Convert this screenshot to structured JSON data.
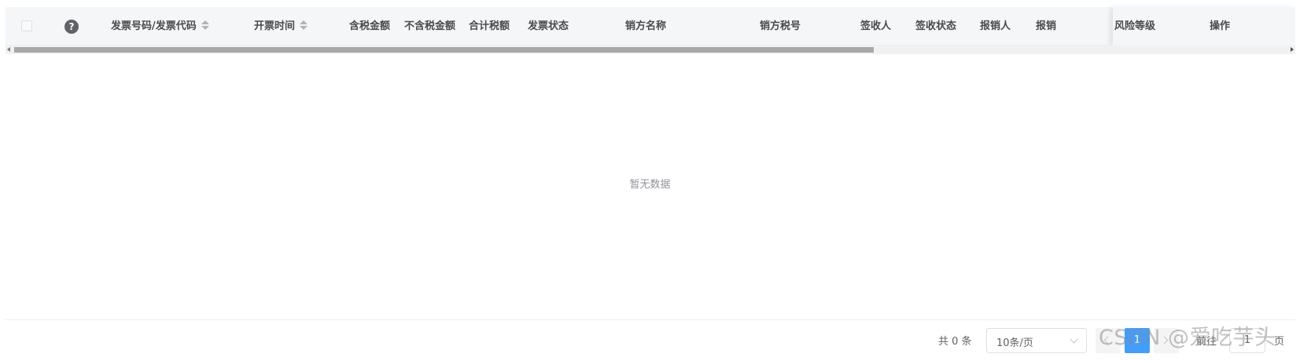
{
  "table": {
    "columns": [
      {
        "key": "invoice_no",
        "label": "发票号码/发票代码",
        "sortable": true
      },
      {
        "key": "issue_time",
        "label": "开票时间",
        "sortable": true
      },
      {
        "key": "amount_with_tax",
        "label": "含税金额"
      },
      {
        "key": "amount_without_tax",
        "label": "不含税金额"
      },
      {
        "key": "total_tax",
        "label": "合计税额"
      },
      {
        "key": "invoice_status",
        "label": "发票状态"
      },
      {
        "key": "seller_name",
        "label": "销方名称"
      },
      {
        "key": "seller_tax_id",
        "label": "销方税号"
      },
      {
        "key": "receiver",
        "label": "签收人"
      },
      {
        "key": "receipt_status",
        "label": "签收状态"
      },
      {
        "key": "reimburser",
        "label": "报销人"
      },
      {
        "key": "reimburse_partial",
        "label": "报销"
      }
    ],
    "fixed_columns": [
      {
        "key": "risk_level",
        "label": "风险等级"
      },
      {
        "key": "actions",
        "label": "操作"
      }
    ],
    "help_icon_glyph": "?",
    "empty_text": "暂无数据"
  },
  "pagination": {
    "total_text": "共 0 条",
    "page_size_value": "10条/页",
    "current_page": "1",
    "jump_prefix": "前往",
    "jump_value": "1",
    "jump_suffix": "页"
  },
  "watermark": "CSDN @爱吃芋头",
  "colors": {
    "accent": "#409eff",
    "header_bg": "#f5f6f8",
    "muted_text": "#909399"
  },
  "icons": [
    "checkbox",
    "help-icon",
    "sort-icon",
    "chevron-down-icon",
    "chevron-left-icon",
    "chevron-right-icon"
  ]
}
